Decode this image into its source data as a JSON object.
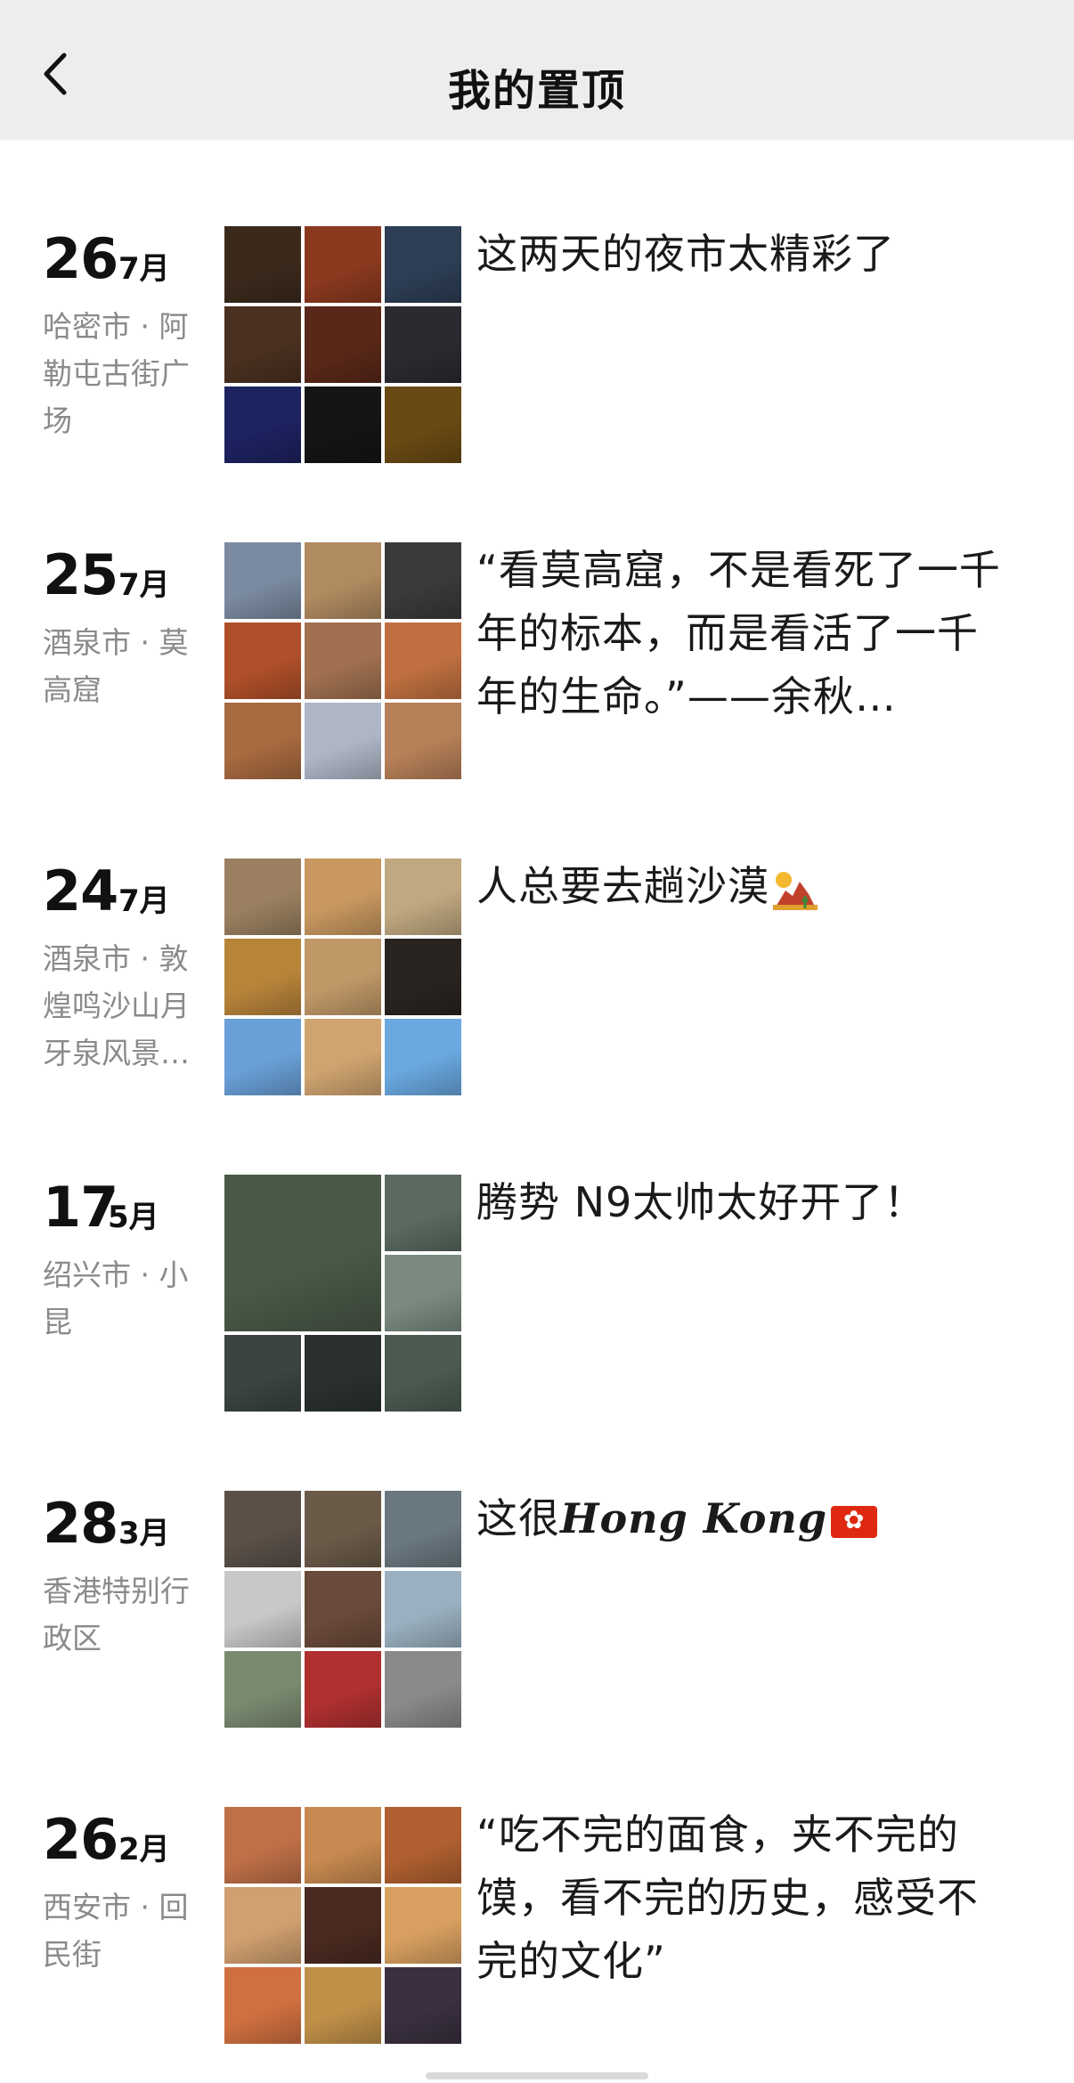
{
  "nav": {
    "title": "我的置顶"
  },
  "posts": [
    {
      "day": "26",
      "month": "7月",
      "location": "哈密市 · 阿勒屯古街广场",
      "caption": "这两天的夜市太精彩了",
      "tiles": [
        "#3b2a1c",
        "#8c3a1f",
        "#2d3e55",
        "#4a3020",
        "#5a2818",
        "#2a2a30",
        "#1d2260",
        "#141414",
        "#6a4a14"
      ]
    },
    {
      "day": "25",
      "month": "7月",
      "location": "酒泉市 · 莫高窟",
      "caption": "“看莫高窟，不是看死了一千年的标本，而是看活了一千年的生命。”——余秋…",
      "tiles": [
        "#7a8aa0",
        "#b08a60",
        "#3a3a3a",
        "#b0502a",
        "#a07050",
        "#c07040",
        "#a86a40",
        "#aeb6c6",
        "#b68058"
      ]
    },
    {
      "day": "24",
      "month": "7月",
      "location": "酒泉市 · 敦煌鸣沙山月牙泉风景…",
      "caption": "人总要去趟沙漠",
      "tiles": [
        "#9a8060",
        "#c89860",
        "#c0a880",
        "#b8843a",
        "#c09868",
        "#2a2420",
        "#6aa0d8",
        "#d0a470",
        "#6aa8e0"
      ]
    },
    {
      "day": "17",
      "month": "5月",
      "location": "绍兴市 · 小昆",
      "caption": "腾势 N9太帅太好开了！",
      "tiles": [
        "#4a5a48",
        "#5a6a60",
        "#7a8a80",
        "#3a4440",
        "#2a3030",
        "#4a5a50"
      ]
    },
    {
      "day": "28",
      "month": "3月",
      "location": "香港特别行政区",
      "caption_prefix": "这很",
      "caption_italic": "Hong Kong",
      "tiles": [
        "#5a5048",
        "#6a5a48",
        "#6a7880",
        "#c8c8c8",
        "#6a4a3a",
        "#9ab0c0",
        "#7a8a70",
        "#b03030",
        "#8a8a8a"
      ]
    },
    {
      "day": "26",
      "month": "2月",
      "location": "西安市 · 回民街",
      "caption": "“吃不完的面食，夹不完的馍，看不完的历史，感受不完的文化”",
      "tiles": [
        "#c07048",
        "#c88a50",
        "#b06030",
        "#d0a070",
        "#4a2a20",
        "#d8a060",
        "#d07040",
        "#c09048",
        "#3a3040"
      ]
    }
  ]
}
